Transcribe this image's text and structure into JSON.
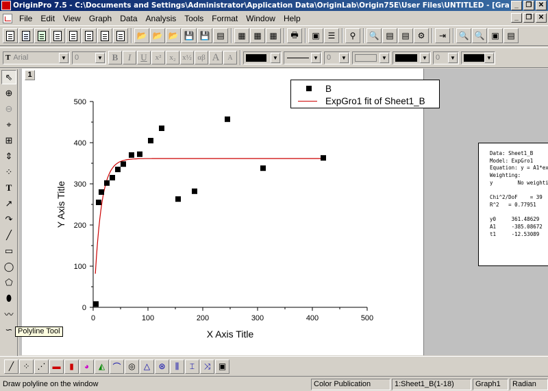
{
  "window": {
    "title": "OriginPro 7.5 - C:\\Documents and Settings\\Administrator\\Application Data\\OriginLab\\Origin75E\\User Files\\UNTITLED - [Graph1]",
    "minimize_glyph": "_",
    "restore_glyph": "❐",
    "close_glyph": "✕"
  },
  "menubar": {
    "items": [
      {
        "label": "File"
      },
      {
        "label": "Edit"
      },
      {
        "label": "View"
      },
      {
        "label": "Graph"
      },
      {
        "label": "Data"
      },
      {
        "label": "Analysis"
      },
      {
        "label": "Tools"
      },
      {
        "label": "Format"
      },
      {
        "label": "Window"
      },
      {
        "label": "Help"
      }
    ]
  },
  "format_toolbar": {
    "font_name": "Arial",
    "font_size": "0",
    "bold": "B",
    "italic": "I",
    "underline": "U",
    "superscript": "x²",
    "subscript": "x₂",
    "supsub": "x½",
    "greek": "αβ",
    "increase_font": "A",
    "decrease_font": "A",
    "line_size": "0",
    "pattern_size": "0"
  },
  "layer": {
    "number": "1"
  },
  "chart_data": {
    "type": "scatter",
    "xlabel": "X Axis Title",
    "ylabel": "Y Axis Title",
    "xlim": [
      0,
      500
    ],
    "ylim": [
      0,
      500
    ],
    "x_ticks": [
      "0",
      "100",
      "200",
      "300",
      "400",
      "500"
    ],
    "y_ticks": [
      "0",
      "100",
      "200",
      "300",
      "400",
      "500"
    ],
    "legend_position": "top-right",
    "series": [
      {
        "name": "B",
        "marker": "square",
        "color": "#000000",
        "x": [
          5,
          10,
          15,
          25,
          35,
          45,
          55,
          70,
          85,
          105,
          125,
          155,
          185,
          245,
          310,
          420
        ],
        "y": [
          8,
          255,
          280,
          302,
          315,
          335,
          348,
          370,
          372,
          405,
          435,
          263,
          282,
          457,
          338,
          363
        ]
      },
      {
        "name": "ExpGro1 fit of Sheet1_B",
        "style": "line",
        "color": "#cc0000",
        "model": {
          "y0": 361.48629,
          "A1": -385.08672,
          "t1": -12.53089
        }
      }
    ]
  },
  "fit_results": {
    "lines": [
      "Data: Sheet1_B",
      "Model: ExpGro1",
      "Equation: y = A1*exp",
      "Weighting:",
      "y        No weighting",
      "",
      "Chi^2/DoF    = 39",
      "R^2   = 0.77951",
      "",
      "y0     361.48629",
      "A1     -385.08672",
      "t1     -12.53089"
    ]
  },
  "tooltip": {
    "text": "Polyline Tool"
  },
  "statusbar": {
    "message": "Draw polyline on the window",
    "theme": "Color Publication",
    "dataset": "1:Sheet1_B(1-18)",
    "window_name": "Graph1",
    "angle_unit": "Radian"
  },
  "colors": {
    "title_bar": "#0a246a",
    "fit_line": "#cc0000",
    "chrome": "#d4d0c8"
  }
}
